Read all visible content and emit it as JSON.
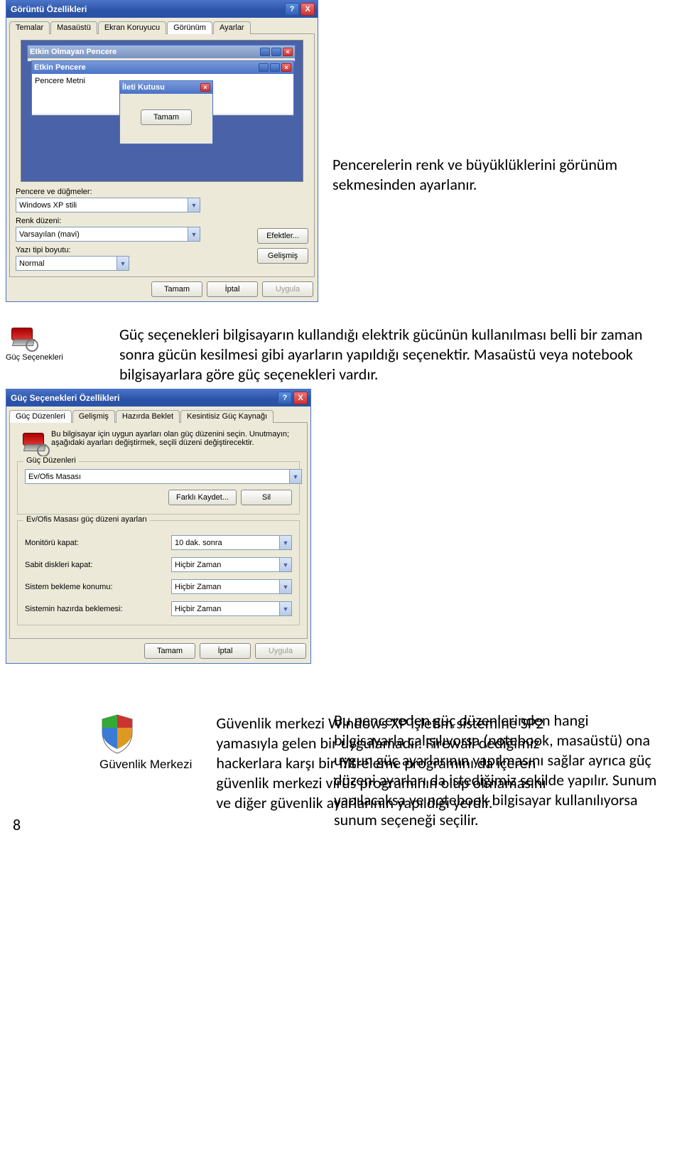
{
  "pageNumber": "8",
  "display_dialog": {
    "title": "Görüntü Özellikleri",
    "help_btn": "?",
    "close_btn": "X",
    "tabs": [
      "Temalar",
      "Masaüstü",
      "Ekran Koruyucu",
      "Görünüm",
      "Ayarlar"
    ],
    "active_tab": "Görünüm",
    "preview": {
      "inactive_title": "Etkin Olmayan Pencere",
      "active_title": "Etkin Pencere",
      "body_text": "Pencere Metni",
      "msgbox_title": "İleti Kutusu",
      "msgbox_ok": "Tamam"
    },
    "labels": {
      "windows_buttons": "Pencere ve düğmeler:",
      "color_scheme": "Renk düzeni:",
      "font_size": "Yazı tipi boyutu:"
    },
    "values": {
      "windows_buttons": "Windows XP stili",
      "color_scheme": "Varsayılan (mavi)",
      "font_size": "Normal"
    },
    "buttons": {
      "effects": "Efektler...",
      "advanced": "Gelişmiş",
      "ok": "Tamam",
      "cancel": "İptal",
      "apply": "Uygula"
    }
  },
  "para1": "Pencerelerin renk ve büyüklüklerini görünüm sekmesinden ayarlanır.",
  "power_icon_label": "Güç Seçenekleri",
  "para2": "Güç seçenekleri bilgisayarın kullandığı elektrik gücünün kullanılması belli bir zaman sonra gücün kesilmesi gibi ayarların yapıldığı seçenektir. Masaüstü veya notebook bilgisayarlara göre güç seçenekleri vardır.",
  "power_dialog": {
    "title": "Güç Seçenekleri Özellikleri",
    "tabs": [
      "Güç Düzenleri",
      "Gelişmiş",
      "Hazırda Beklet",
      "Kesintisiz Güç Kaynağı"
    ],
    "active_tab": "Güç Düzenleri",
    "message": "Bu bilgisayar için uygun ayarları olan güç düzenini seçin. Unutmayın; aşağıdaki ayarları değiştirmek, seçili düzeni değiştirecektir.",
    "scheme_legend": "Güç Düzenleri",
    "scheme_value": "Ev/Ofis Masası",
    "save_as": "Farklı Kaydet...",
    "delete": "Sil",
    "settings_legend": "Ev/Ofis Masası güç düzeni ayarları",
    "rows": {
      "monitor_label": "Monitörü kapat:",
      "monitor_value": "10 dak. sonra",
      "hdd_label": "Sabit diskleri kapat:",
      "hdd_value": "Hiçbir Zaman",
      "standby_label": "Sistem bekleme konumu:",
      "standby_value": "Hiçbir Zaman",
      "hibernate_label": "Sistemin hazırda beklemesi:",
      "hibernate_value": "Hiçbir Zaman"
    },
    "buttons": {
      "ok": "Tamam",
      "cancel": "İptal",
      "apply": "Uygula"
    }
  },
  "para3": "Bu pencereden güç düzenlerinden hangi bilgisayarla çalışılıyorsa (notebook, masaüstü) ona uygun güç ayarlarının yapılmasını sağlar ayrıca güç düzeni ayarları da istediğimiz şekilde yapılır. Sunum yapılacaksa ve notebook bilgisayar kullanılıyorsa sunum seçeneği seçilir.",
  "security_icon_label": "Güvenlik Merkezi",
  "para4": "Güvenlik merkezi Windows XP işletim sistemine SP2 yamasıyla gelen bir uygulamadır. Firewall dediğimiz hackerlara karşı bir filtreleme programını da içeren güvenlik merkezi virüs programının olup olmamasını ve diğer güvenlik ayarlarının yapıldığı yerdir."
}
